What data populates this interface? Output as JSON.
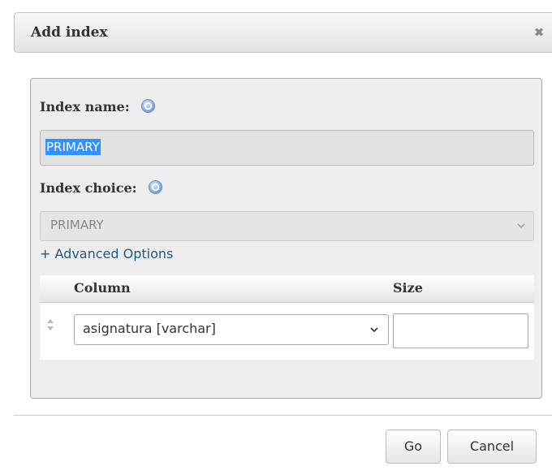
{
  "dialog": {
    "title": "Add index",
    "close_icon": "close-icon"
  },
  "form": {
    "index_name_label": "Index name:",
    "index_name_value": "PRIMARY",
    "index_name_selected": true,
    "index_choice_label": "Index choice:",
    "index_choice_value": "PRIMARY",
    "index_choice_disabled": true,
    "help_icon": "help-icon",
    "advanced_options_link": "+ Advanced Options"
  },
  "columns_table": {
    "headers": [
      "",
      "Column",
      "Size"
    ],
    "rows": [
      {
        "drag_icon": "drag-handle-icon",
        "column": "asignatura [varchar]",
        "size": ""
      }
    ]
  },
  "buttons": {
    "go_label": "Go",
    "cancel_label": "Cancel"
  },
  "colors": {
    "link": "#235a81",
    "selection": "#3390ff",
    "panel_bg": "#eeeeee"
  }
}
